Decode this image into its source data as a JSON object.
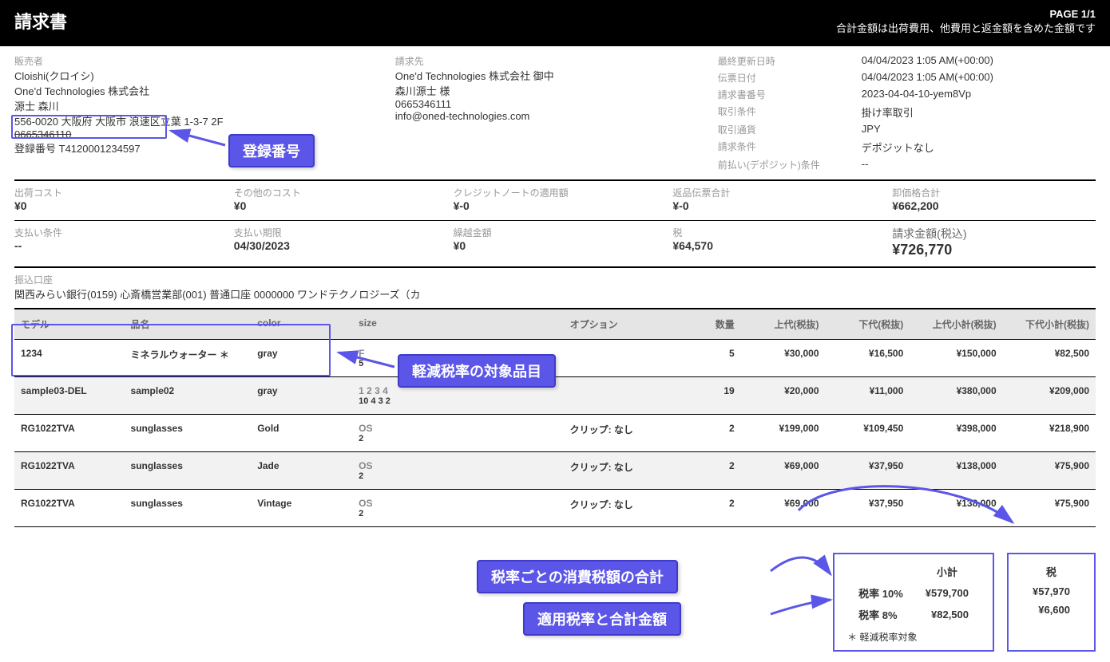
{
  "header": {
    "title": "請求書",
    "page": "PAGE 1/1",
    "note": "合計金額は出荷費用、他費用と返金額を含めた金額です"
  },
  "seller": {
    "label": "販売者",
    "name": "Cloishi(クロイシ)",
    "company": "One'd Technologies 株式会社",
    "person": "源士 森川",
    "address": "556-0020 大阪府 大阪市 浪速区立葉 1-3-7 2F",
    "phone": "0665346110",
    "reg_label": "登録番号",
    "reg_no": "T4120001234597"
  },
  "billto": {
    "label": "請求先",
    "company": "One'd Technologies 株式会社 御中",
    "person": "森川源士 様",
    "phone": "0665346111",
    "email": "info@oned-technologies.com"
  },
  "meta": {
    "updated_lbl": "最終更新日時",
    "updated": "04/04/2023 1:05 AM(+00:00)",
    "slip_lbl": "伝票日付",
    "slip": "04/04/2023 1:05 AM(+00:00)",
    "invno_lbl": "請求書番号",
    "invno": "2023-04-04-10-yem8Vp",
    "terms_lbl": "取引条件",
    "terms": "掛け率取引",
    "cur_lbl": "取引通貨",
    "cur": "JPY",
    "cond_lbl": "請求条件",
    "cond": "デポジットなし",
    "prepay_lbl": "前払い(デポジット)条件",
    "prepay": "--"
  },
  "costs": {
    "ship_lbl": "出荷コスト",
    "ship": "¥0",
    "other_lbl": "その他のコスト",
    "other": "¥0",
    "credit_lbl": "クレジットノートの適用額",
    "credit": "¥-0",
    "return_lbl": "返品伝票合計",
    "return": "¥-0",
    "whole_lbl": "卸価格合計",
    "whole": "¥662,200"
  },
  "payment": {
    "payterms_lbl": "支払い条件",
    "payterms": "--",
    "due_lbl": "支払い期限",
    "due": "04/30/2023",
    "carry_lbl": "繰越金額",
    "carry": "¥0",
    "tax_lbl": "税",
    "tax": "¥64,570",
    "total_lbl": "請求金額(税込)",
    "total": "¥726,770"
  },
  "bank": {
    "label": "振込口座",
    "info": "関西みらい銀行(0159) 心斎橋営業部(001) 普通口座 0000000 ワンドテクノロジーズ（カ"
  },
  "table": {
    "headers": {
      "model": "モデル",
      "name": "品名",
      "color": "color",
      "size": "size",
      "option": "オプション",
      "qty": "数量",
      "list": "上代(税抜)",
      "cost": "下代(税抜)",
      "listsub": "上代小計(税抜)",
      "costsub": "下代小計(税抜)"
    },
    "rows": [
      {
        "model": "1234",
        "name": "ミネラルウォーター ＊",
        "color": "gray",
        "size1": "F",
        "size2": "5",
        "option": "",
        "qty": "5",
        "list": "¥30,000",
        "cost": "¥16,500",
        "listsub": "¥150,000",
        "costsub": "¥82,500",
        "alt": false
      },
      {
        "model": "sample03-DEL",
        "name": "sample02",
        "color": "gray",
        "size1": "1   2   3   4",
        "size2": "10  4   3   2",
        "option": "",
        "qty": "19",
        "list": "¥20,000",
        "cost": "¥11,000",
        "listsub": "¥380,000",
        "costsub": "¥209,000",
        "alt": true
      },
      {
        "model": "RG1022TVA",
        "name": "sunglasses",
        "color": "Gold",
        "size1": "OS",
        "size2": "2",
        "option": "クリップ: なし",
        "qty": "2",
        "list": "¥199,000",
        "cost": "¥109,450",
        "listsub": "¥398,000",
        "costsub": "¥218,900",
        "alt": false
      },
      {
        "model": "RG1022TVA",
        "name": "sunglasses",
        "color": "Jade",
        "size1": "OS",
        "size2": "2",
        "option": "クリップ: なし",
        "qty": "2",
        "list": "¥69,000",
        "cost": "¥37,950",
        "listsub": "¥138,000",
        "costsub": "¥75,900",
        "alt": true
      },
      {
        "model": "RG1022TVA",
        "name": "sunglasses",
        "color": "Vintage",
        "size1": "OS",
        "size2": "2",
        "option": "クリップ: なし",
        "qty": "2",
        "list": "¥69,000",
        "cost": "¥37,950",
        "listsub": "¥138,000",
        "costsub": "¥75,900",
        "alt": false
      }
    ]
  },
  "taxbox": {
    "sub_lbl": "小計",
    "tax_lbl": "税",
    "rate10_lbl": "税率 10%",
    "rate10_sub": "¥579,700",
    "rate10_tax": "¥57,970",
    "rate8_lbl": "税率 8%",
    "rate8_sub": "¥82,500",
    "rate8_tax": "¥6,600",
    "note": "＊ 軽減税率対象"
  },
  "callouts": {
    "reg": "登録番号",
    "reduced": "軽減税率の対象品目",
    "taxsum": "税率ごとの消費税額の合計",
    "ratesum": "適用税率と合計金額"
  }
}
